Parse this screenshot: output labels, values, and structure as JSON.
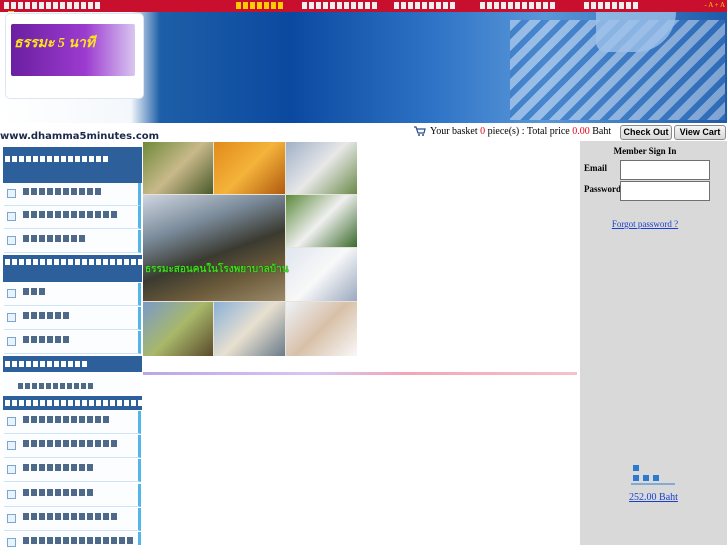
{
  "site": {
    "url_text": "www.dhamma5minutes.com",
    "logo_text": "ธรรมะ 5 นาที"
  },
  "topbar": {
    "font_size_controls": "- A  + A"
  },
  "basket": {
    "prefix": "Your basket",
    "count": "0",
    "pieces_label": "piece(s) : Total price",
    "price": "0.00",
    "currency": "Baht",
    "checkout_label": "Check Out",
    "view_cart_label": "View Cart"
  },
  "collage": {
    "caption": "ธรรมะสอนคนในโรงพยาบาลบ้าน"
  },
  "member": {
    "title": "Member Sign In",
    "email_label": "Email",
    "email_value": "",
    "password_label": "Password",
    "password_value": "",
    "forgot_label": "Forgot password ?"
  },
  "total": {
    "amount": "252.00 Baht"
  },
  "colors": {
    "topbar": "#c8102e",
    "sidebar_header": "#2d5f9a",
    "link": "#1a3fcc",
    "price_red": "#e0001a"
  }
}
